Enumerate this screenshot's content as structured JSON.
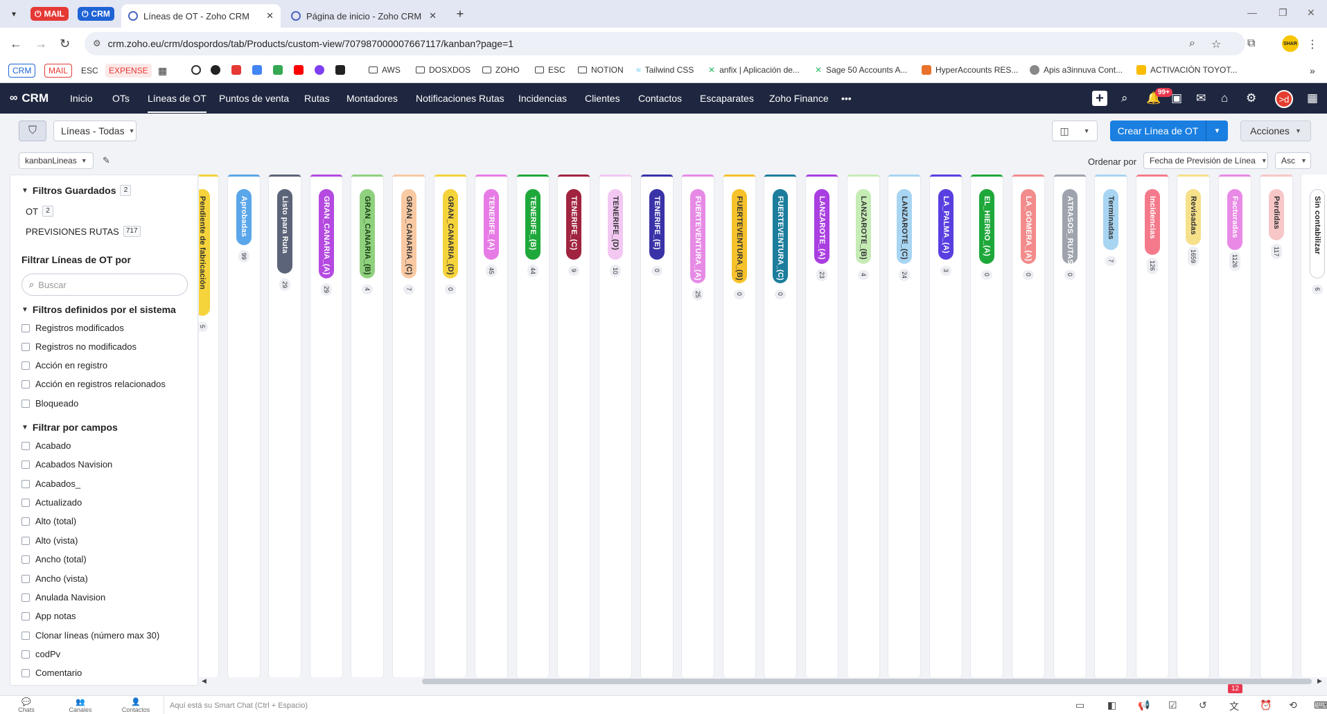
{
  "browser": {
    "pinned": [
      {
        "label": "MAIL",
        "color": "#e53935"
      },
      {
        "label": "CRM",
        "color": "#1e63d4"
      }
    ],
    "tabs": [
      {
        "title": "Líneas de OT - Zoho CRM",
        "active": true
      },
      {
        "title": "Página de inicio - Zoho CRM",
        "active": false
      }
    ],
    "url": "crm.zoho.eu/crm/dospordos/tab/Products/custom-view/707987000007667117/kanban?page=1",
    "profile_label": "SHAR",
    "bookmarks_tags": [
      {
        "label": "CRM",
        "color": "#1e63d4"
      },
      {
        "label": "MAIL",
        "color": "#e53935"
      },
      {
        "label": "ESC",
        "color": "#333333"
      },
      {
        "label": "EXPENSE",
        "color": "#e53935"
      }
    ],
    "bookmarks": [
      "AWS",
      "DOSXDOS",
      "ZOHO",
      "ESC",
      "NOTION",
      "Tailwind CSS",
      "anfix | Aplicación de...",
      "Sage 50 Accounts A...",
      "HyperAccounts RES...",
      "Apis a3innuva Cont...",
      "ACTIVACIÓN TOYOT..."
    ]
  },
  "crm_nav": {
    "logo": "CRM",
    "items": [
      "Inicio",
      "OTs",
      "Líneas de OT",
      "Puntos de venta",
      "Rutas",
      "Montadores",
      "Notificaciones Rutas",
      "Incidencias",
      "Clientes",
      "Contactos",
      "Escaparates",
      "Zoho Finance"
    ],
    "active": "Líneas de OT",
    "more": "•••",
    "notif_badge": "99+",
    "avatar": ">d"
  },
  "toolbar": {
    "view": "Líneas - Todas",
    "create_label": "Crear Línea de OT",
    "actions_label": "Acciones",
    "kanban_view": "kanbanLineas",
    "sort_label": "Ordenar por",
    "sort_field": "Fecha de Previsión de Línea",
    "sort_dir": "Asc"
  },
  "sidebar": {
    "saved_title": "Filtros Guardados",
    "saved_count": "2",
    "saved": [
      {
        "label": "OT",
        "count": "2"
      },
      {
        "label": "PREVISIONES RUTAS",
        "count": "717"
      }
    ],
    "filter_title": "Filtrar Líneas de OT por",
    "search_placeholder": "Buscar",
    "system_title": "Filtros definidos por el sistema",
    "system": [
      "Registros modificados",
      "Registros no modificados",
      "Acción en registro",
      "Acción en registros relacionados",
      "Bloqueado"
    ],
    "fields_title": "Filtrar por campos",
    "fields": [
      "Acabado",
      "Acabados Navision",
      "Acabados_",
      "Actualizado",
      "Alto (total)",
      "Alto (vista)",
      "Ancho (total)",
      "Ancho (vista)",
      "Anulada Navision",
      "App notas",
      "Clonar líneas (número max 30)",
      "codPv",
      "Comentario"
    ]
  },
  "kanban": {
    "columns": [
      {
        "name": "Pendiente de fabricación",
        "count": "5",
        "color": "#f5d33a",
        "text": "#333333"
      },
      {
        "name": "Aprobadas",
        "count": "99",
        "color": "#5aa6ea",
        "text": "#ffffff"
      },
      {
        "name": "Listo para Ruta",
        "count": "29",
        "color": "#5b6478",
        "text": "#ffffff"
      },
      {
        "name": "GRAN_CANARIA_(A)",
        "count": "29",
        "color": "#b44ae0",
        "text": "#ffffff"
      },
      {
        "name": "GRAN_CANARIA_(B)",
        "count": "4",
        "color": "#8fd17e",
        "text": "#1a3d12"
      },
      {
        "name": "GRAN_CANARIA_(C)",
        "count": "7",
        "color": "#f8c9a3",
        "text": "#333333"
      },
      {
        "name": "GRAN_CANARIA_(D)",
        "count": "0",
        "color": "#f5d33a",
        "text": "#333333"
      },
      {
        "name": "TENERIFE_(A)",
        "count": "45",
        "color": "#e77be6",
        "text": "#ffffff"
      },
      {
        "name": "TENERIFE_(B)",
        "count": "44",
        "color": "#1fa83a",
        "text": "#ffffff"
      },
      {
        "name": "TENERIFE_(C)",
        "count": "9",
        "color": "#a02340",
        "text": "#ffffff"
      },
      {
        "name": "TENERIFE_(D)",
        "count": "10",
        "color": "#f2c8f2",
        "text": "#333333"
      },
      {
        "name": "TENERIFE_(E)",
        "count": "0",
        "color": "#3a32a8",
        "text": "#ffffff"
      },
      {
        "name": "FUERTEVENTURA_(A)",
        "count": "25",
        "color": "#e68ae6",
        "text": "#ffffff"
      },
      {
        "name": "FUERTEVENTURA_(B)",
        "count": "0",
        "color": "#f6c12a",
        "text": "#333333"
      },
      {
        "name": "FUERTEVENTURA_(C)",
        "count": "0",
        "color": "#1c7d9c",
        "text": "#ffffff"
      },
      {
        "name": "LANZAROTE_(A)",
        "count": "23",
        "color": "#a93fe0",
        "text": "#ffffff"
      },
      {
        "name": "LANZAROTE_(B)",
        "count": "4",
        "color": "#c6ecb6",
        "text": "#333333"
      },
      {
        "name": "LANZAROTE_(C)",
        "count": "24",
        "color": "#a8d5f2",
        "text": "#333333"
      },
      {
        "name": "LA_PALMA_(A)",
        "count": "3",
        "color": "#5a3fe0",
        "text": "#ffffff"
      },
      {
        "name": "EL_HIERRO_(A)",
        "count": "0",
        "color": "#1fa83a",
        "text": "#ffffff"
      },
      {
        "name": "LA_GOMERA_(A)",
        "count": "0",
        "color": "#f28b8b",
        "text": "#ffffff"
      },
      {
        "name": "ATRASOS_RUTAS",
        "count": "0",
        "color": "#9ea3ad",
        "text": "#ffffff"
      },
      {
        "name": "Terminadas",
        "count": "7",
        "color": "#a8d5f2",
        "text": "#333333"
      },
      {
        "name": "Incidencias",
        "count": "126",
        "color": "#f47a8b",
        "text": "#ffffff"
      },
      {
        "name": "Revisadas",
        "count": "1659",
        "color": "#f6e08a",
        "text": "#333333"
      },
      {
        "name": "Facturadas",
        "count": "1126",
        "color": "#e88ae6",
        "text": "#ffffff"
      },
      {
        "name": "Perdidas",
        "count": "117",
        "color": "#f7c7c7",
        "text": "#333333"
      },
      {
        "name": "Sin contabilizar",
        "count": "6",
        "color": "#ffffff",
        "text": "#222222"
      }
    ]
  },
  "footer": {
    "items": [
      "Chats",
      "Canales",
      "Contactos"
    ],
    "smart_chat": "Aquí está su Smart Chat (Ctrl + Espacio)",
    "badge": "12"
  }
}
